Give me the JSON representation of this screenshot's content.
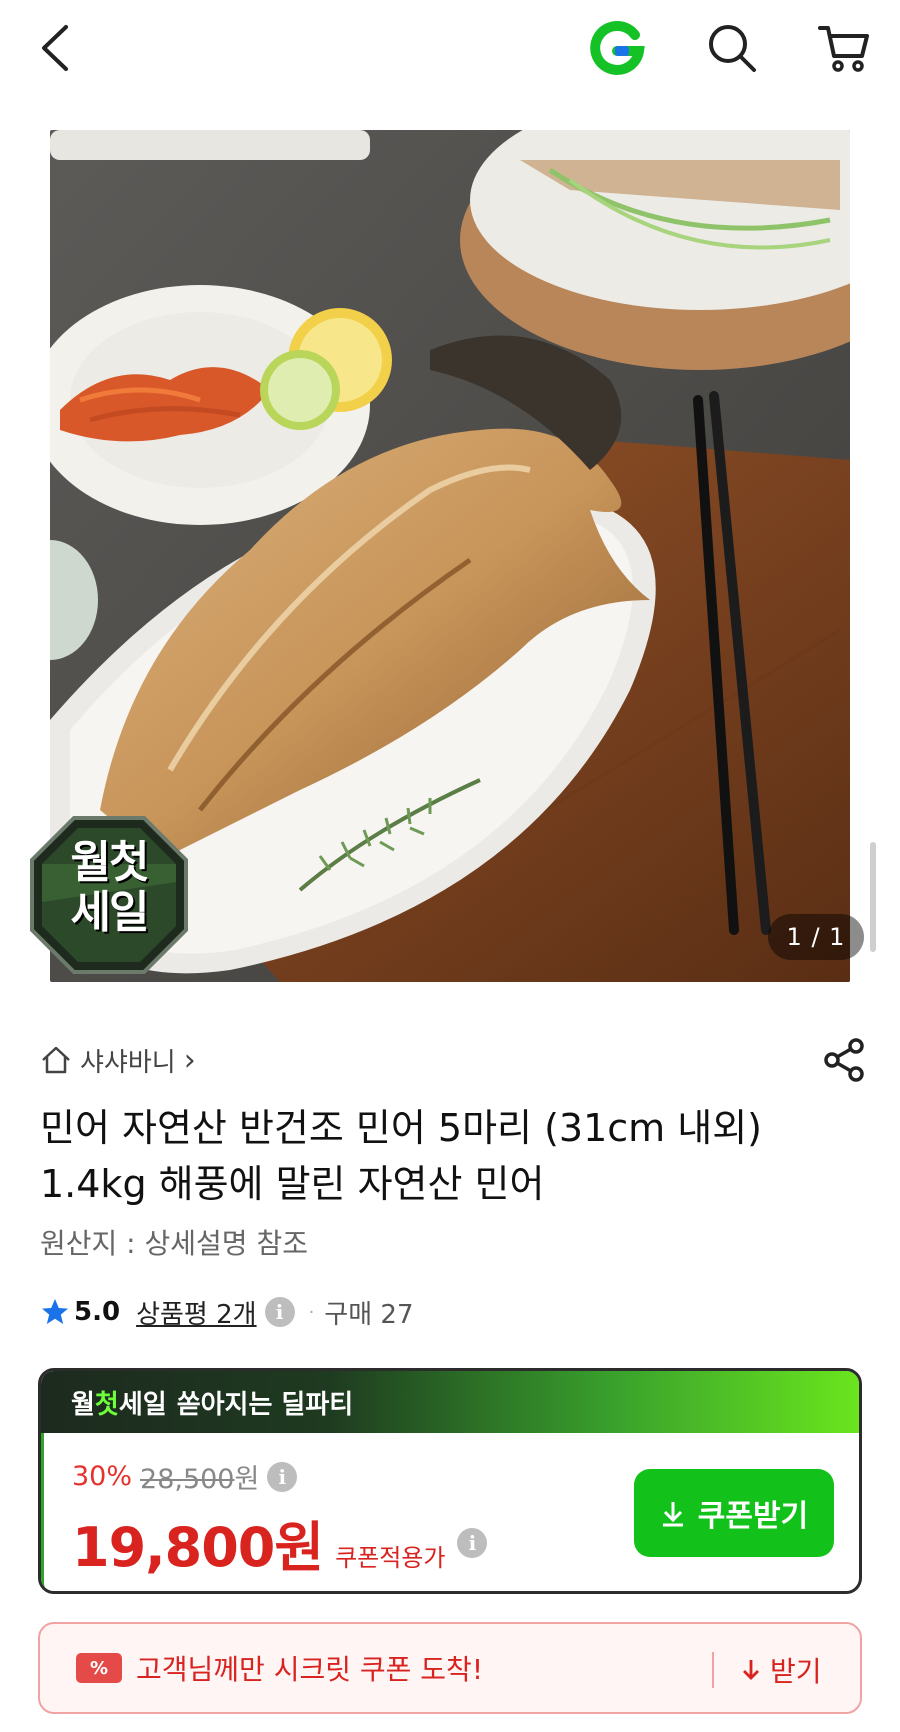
{
  "header": {
    "back_icon": "chevron-left-icon",
    "logo_icon": "g-logo-icon",
    "search_icon": "search-icon",
    "cart_icon": "cart-icon",
    "logo_color": "#15c225"
  },
  "hero": {
    "image_description_icon": "grilled-dried-fish-photo",
    "badge_line1": "월첫",
    "badge_line2": "세일",
    "page_indicator": "1 / 1"
  },
  "seller": {
    "name": "샤샤바니",
    "chevron": "›"
  },
  "product": {
    "title": "민어 자연산 반건조 민어 5마리 (31cm 내외) 1.4kg 해풍에 말린 자연산 민어",
    "origin": "원산지 : 상세설명 참조"
  },
  "rating": {
    "score": "5.0",
    "review_label": "상품평 2개",
    "separator": "·",
    "purchase": "구매 27",
    "star_color": "#1a73e8"
  },
  "deal": {
    "header_part1": "월",
    "header_part2": "첫",
    "header_part3": "세일",
    "header_tail": "쏟아지는 딜파티",
    "discount_pct": "30%",
    "original_price": "28,500",
    "original_unit": "원",
    "sale_price": "19,800원",
    "coupon_note": "쿠폰적용가",
    "coupon_button": "쿠폰받기",
    "accent_green": "#12c21b",
    "price_red": "#d8231f"
  },
  "secret_coupon": {
    "ticket_label": "%",
    "message": "고객님께만 시크릿 쿠폰 도착!",
    "receive": "받기"
  },
  "info_glyph": "i"
}
